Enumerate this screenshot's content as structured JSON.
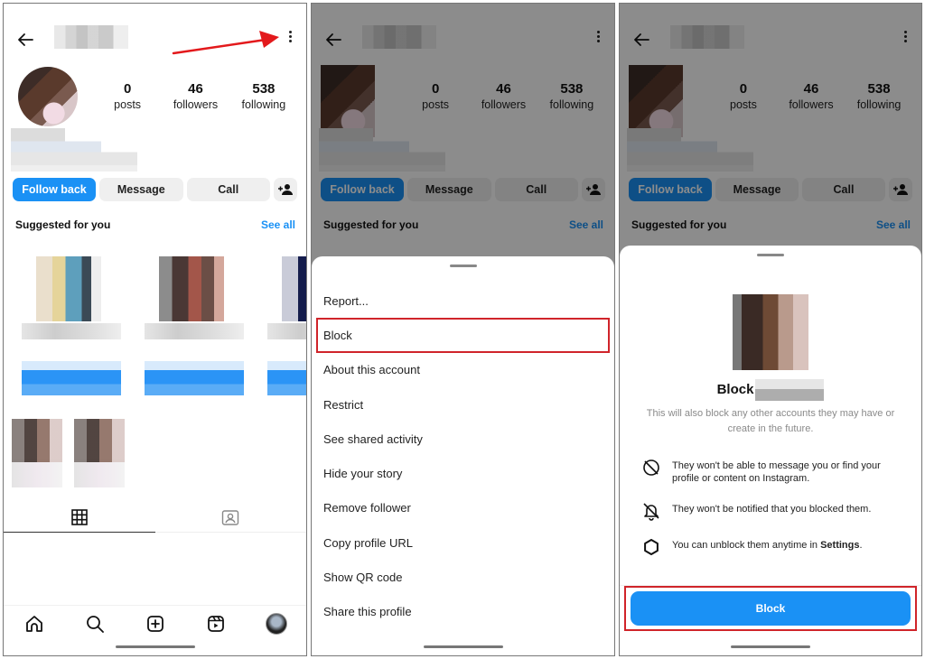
{
  "profile": {
    "stats": [
      {
        "value": "0",
        "label": "posts"
      },
      {
        "value": "46",
        "label": "followers"
      },
      {
        "value": "538",
        "label": "following"
      }
    ],
    "actions": {
      "follow_back": "Follow back",
      "message": "Message",
      "call": "Call"
    },
    "suggested": {
      "title": "Suggested for you",
      "see_all": "See all"
    }
  },
  "menu": {
    "items": [
      "Report...",
      "Block",
      "About this account",
      "Restrict",
      "See shared activity",
      "Hide your story",
      "Remove follower",
      "Copy profile URL",
      "Show QR code",
      "Share this profile"
    ],
    "highlighted": "Block"
  },
  "block_dialog": {
    "title_prefix": "Block",
    "subtitle": "This will also block any other accounts they may have or create in the future.",
    "facts": [
      {
        "icon": "no-message-icon",
        "text": "They won't be able to message you or find your profile or content on Instagram."
      },
      {
        "icon": "bell-off-icon",
        "text": "They won't be notified that you blocked them."
      },
      {
        "icon": "settings-gear-icon",
        "text_before": "You can unblock them anytime in ",
        "bold": "Settings",
        "text_after": "."
      }
    ],
    "button": "Block"
  },
  "colors": {
    "accent_blue": "#1a91f5",
    "highlight_red": "#d0242a"
  }
}
